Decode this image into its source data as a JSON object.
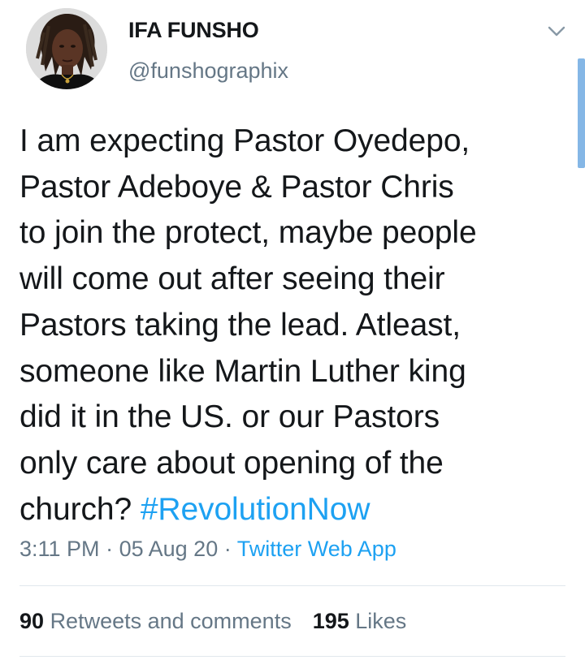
{
  "author": {
    "display_name": "IFA FUNSHO",
    "handle": "@funshographix"
  },
  "tweet": {
    "text_lines": [
      "I am expecting Pastor Oyedepo,",
      "Pastor Adeboye & Pastor Chris",
      "to join the protect, maybe people",
      "will come out after seeing their",
      "Pastors taking the lead. Atleast,",
      "someone like Martin Luther king",
      "did it in the US. or our Pastors",
      "only care about opening of the",
      "church?"
    ],
    "hashtag": "#RevolutionNow",
    "time": "3:11 PM",
    "separator": "·",
    "date": "05 Aug 20",
    "source": "Twitter Web App"
  },
  "stats": {
    "retweets_count": "90",
    "retweets_label": "Retweets and comments",
    "likes_count": "195",
    "likes_label": "Likes"
  },
  "icons": {
    "menu": "chevron-down-icon"
  },
  "colors": {
    "text": "#14171a",
    "secondary": "#657786",
    "link": "#1da1f2",
    "divider": "#e1e8ed",
    "scrollbar": "#85b7e6"
  }
}
